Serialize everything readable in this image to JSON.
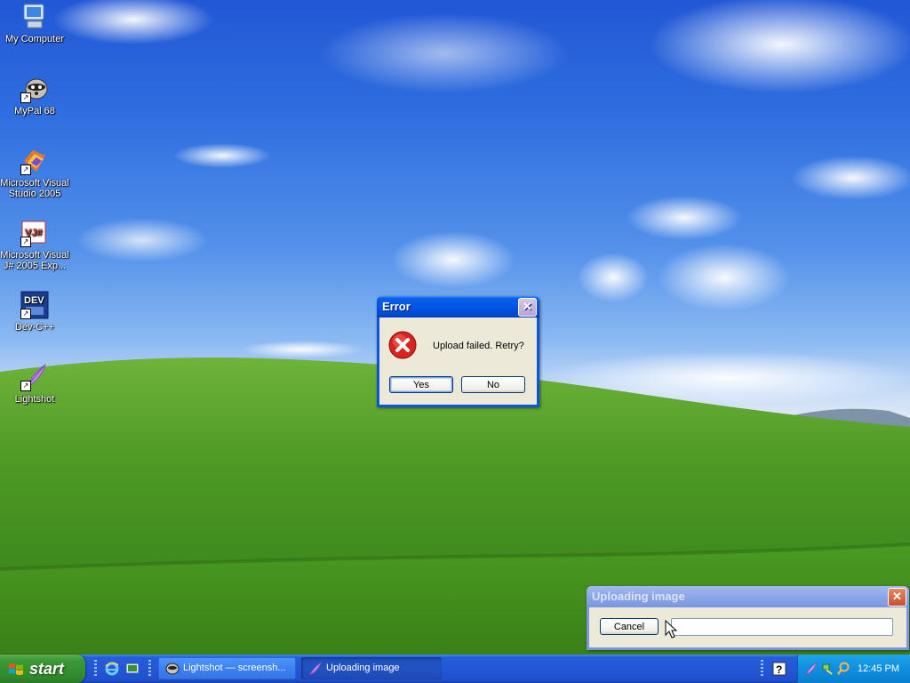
{
  "desktop": {
    "icons": [
      {
        "label": "My Computer",
        "icon": "my-computer-icon"
      },
      {
        "label": "MyPal 68",
        "icon": "mypal-browser-icon"
      },
      {
        "label": "Microsoft Visual Studio 2005",
        "icon": "visual-studio-icon"
      },
      {
        "label": "Microsoft Visual J# 2005 Exp...",
        "icon": "visual-jsharp-icon"
      },
      {
        "label": "Dev-C++",
        "icon": "dev-cpp-icon"
      },
      {
        "label": "Lightshot",
        "icon": "lightshot-feather-icon"
      }
    ]
  },
  "error_dialog": {
    "title": "Error",
    "message": "Upload failed. Retry?",
    "icon": "error-icon",
    "yes_label": "Yes",
    "no_label": "No",
    "close_glyph": "✕"
  },
  "upload_window": {
    "title": "Uploading image",
    "cancel_label": "Cancel",
    "progress": 0,
    "close_glyph": "✕"
  },
  "taskbar": {
    "start_label": "start",
    "quick_launch": [
      "internet-explorer-icon",
      "show-desktop-icon"
    ],
    "buttons": [
      {
        "label": "Lightshot — screensh...",
        "icon": "lightshot-icon"
      },
      {
        "label": "Uploading image",
        "icon": "lightshot-feather-icon"
      }
    ],
    "tray_icons": [
      "help-icon",
      "lightshot-tray-icon",
      "network-icon",
      "search-tray-icon"
    ],
    "clock": "12:45 PM"
  },
  "colors": {
    "title_active": "#0055e5",
    "title_inactive": "#7a96df",
    "taskbar": "#245edb",
    "start_green": "#3c9a35",
    "tray": "#0f8ee0"
  }
}
